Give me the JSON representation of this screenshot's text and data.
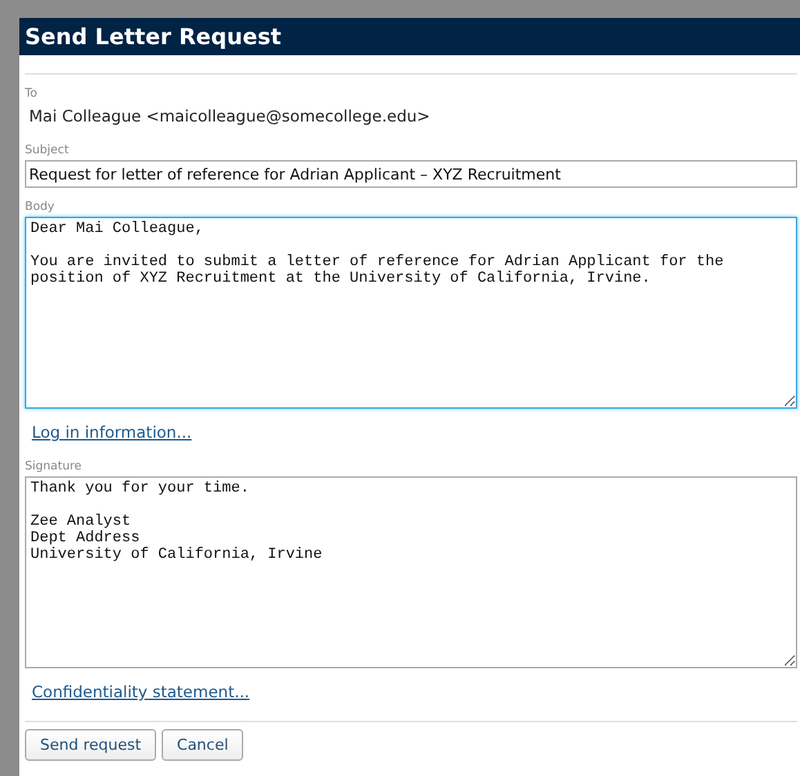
{
  "dialog": {
    "title": "Send Letter Request"
  },
  "fields": [
    {
      "kind": "static",
      "label": "To",
      "value": "Mai Colleague <maicolleague@somecollege.edu>"
    },
    {
      "kind": "input",
      "label": "Subject",
      "value": "Request for letter of reference for Adrian Applicant – XYZ Recruitment"
    },
    {
      "kind": "textarea",
      "label": "Body",
      "value": "Dear Mai Colleague,\n\nYou are invited to submit a letter of reference for Adrian Applicant for the\nposition of XYZ Recruitment at the University of California, Irvine.",
      "focused": true,
      "link": "Log in information..."
    },
    {
      "kind": "textarea",
      "label": "Signature",
      "value": "Thank you for your time.\n\nZee Analyst\nDept Address\nUniversity of California, Irvine",
      "focused": false,
      "link": "Confidentiality statement..."
    }
  ],
  "buttons": [
    "Send request",
    "Cancel"
  ]
}
